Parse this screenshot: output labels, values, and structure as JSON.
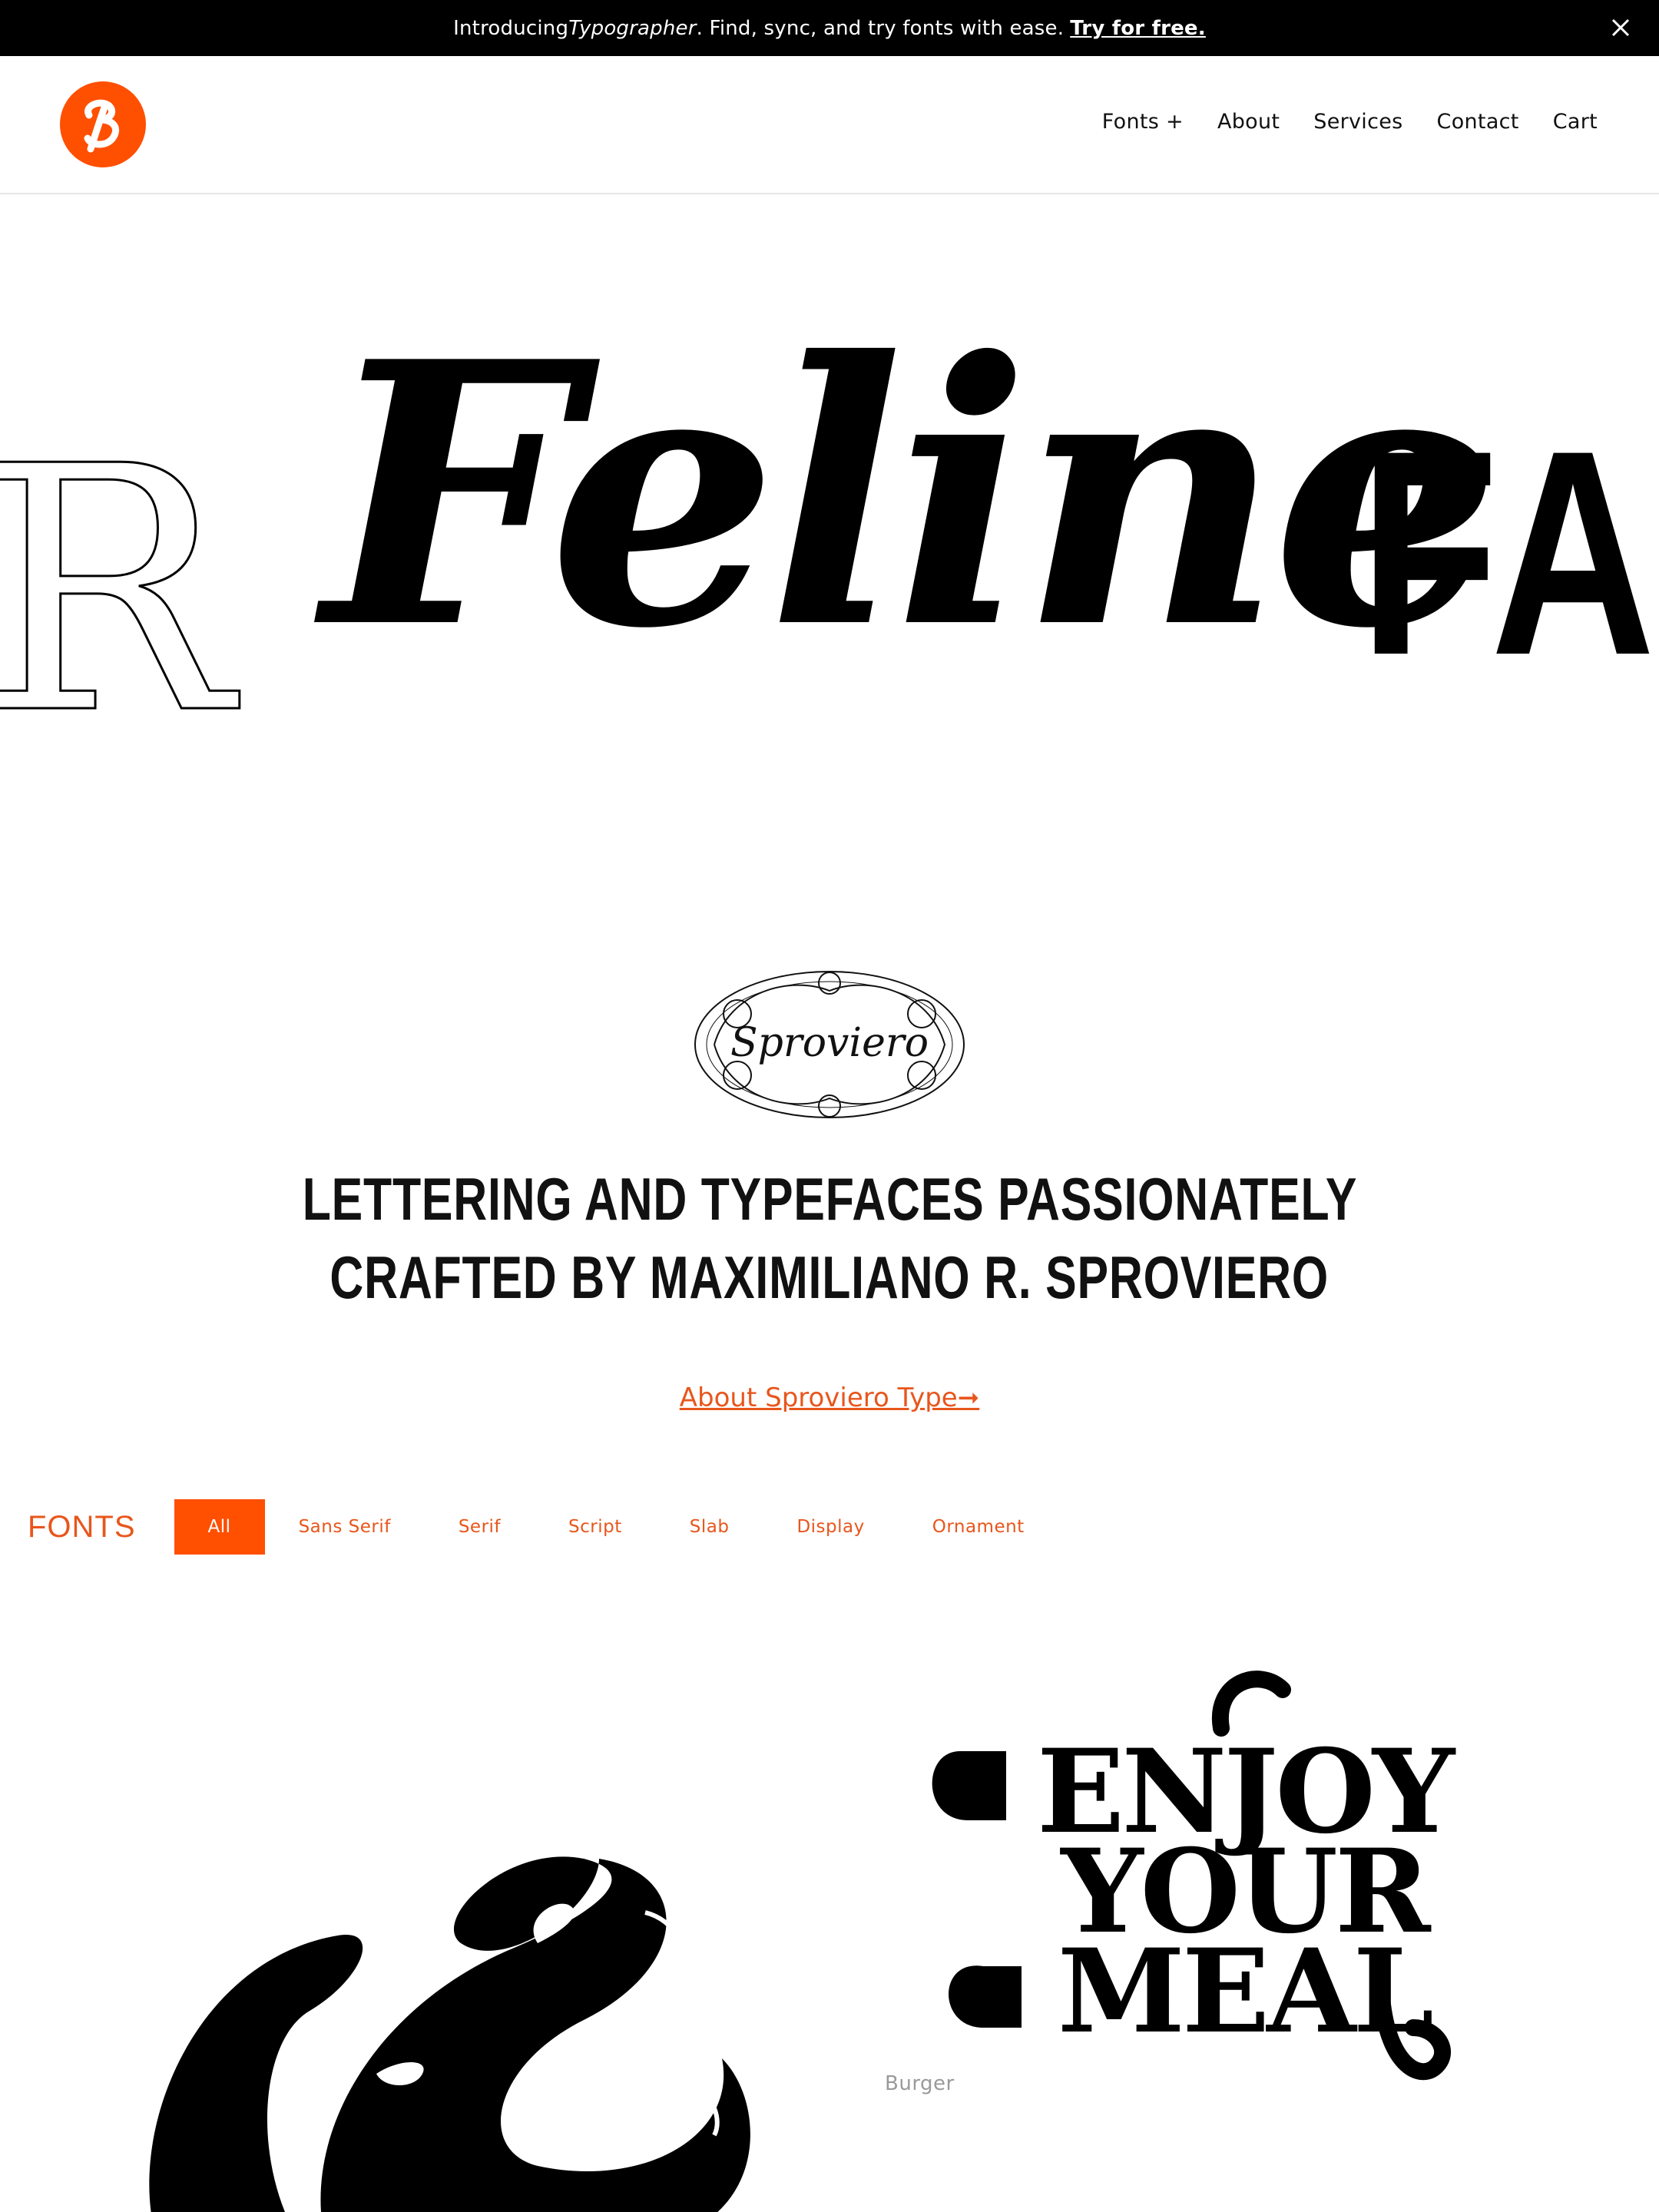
{
  "announcement": {
    "prefix": "Introducing ",
    "product": "Typographer",
    "suffix": ". Find, sync, and try fonts with ease.",
    "cta": "Try for free.",
    "close_icon": "close-icon"
  },
  "header": {
    "logo_icon": "sproviero-logo-icon",
    "nav": [
      {
        "label": "Fonts +"
      },
      {
        "label": "About"
      },
      {
        "label": "Services"
      },
      {
        "label": "Contact"
      },
      {
        "label": "Cart"
      }
    ]
  },
  "hero": {
    "left_word": "R",
    "center_word": "Feline",
    "right_word": "FAB"
  },
  "brand": {
    "monogram_text": "Sproviero",
    "tagline_line1": "LETTERING AND TYPEFACES PASSIONATELY",
    "tagline_line2": "CRAFTED BY MAXIMILIANO R. SPROVIERO",
    "about_link": "About Sproviero Type➞"
  },
  "filters": {
    "heading": "FONTS",
    "chips": [
      {
        "label": "All",
        "active": true
      },
      {
        "label": "Sans Serif"
      },
      {
        "label": "Serif"
      },
      {
        "label": "Script"
      },
      {
        "label": "Slab"
      },
      {
        "label": "Display"
      },
      {
        "label": "Ornament"
      }
    ]
  },
  "tiles": {
    "right_lines": [
      "ENJOY",
      "YOUR",
      "MEAL"
    ],
    "right_label": "Burger"
  },
  "colors": {
    "accent": "#ff4f00",
    "accent_text": "#e8561c",
    "ink": "#000000",
    "muted": "#9a9a9a"
  }
}
